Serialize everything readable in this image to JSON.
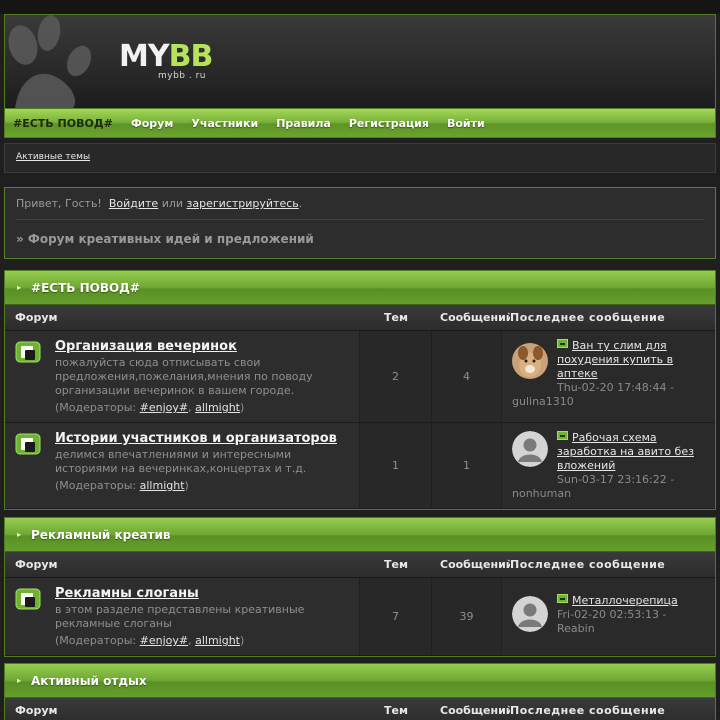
{
  "header": {
    "logo_main": "MY",
    "logo_accent": "BB",
    "logo_sub": "mybb . ru"
  },
  "nav": {
    "items": [
      {
        "label": "#ЕСТЬ ПОВОД#",
        "active": true
      },
      {
        "label": "Форум",
        "active": false
      },
      {
        "label": "Участники",
        "active": false
      },
      {
        "label": "Правила",
        "active": false
      },
      {
        "label": "Регистрация",
        "active": false
      },
      {
        "label": "Войти",
        "active": false
      }
    ]
  },
  "subbar": {
    "active_topics": "Активные темы"
  },
  "greeting": {
    "prefix": "Привет, Гость!",
    "login": "Войдите",
    "or": "или",
    "register": "зарегистрируйтесь",
    "dot": ".",
    "board_title": "» Форум креативных идей и предложений"
  },
  "columns": {
    "forum": "Форум",
    "topics": "Тем",
    "posts": "Сообщений",
    "last": "Последнее сообщение"
  },
  "moderators_label": "(Модераторы:",
  "categories": [
    {
      "title": "#ЕСТЬ ПОВОД#",
      "forums": [
        {
          "name": "Организация вечеринок",
          "desc": "пожалуйста сюда отписывать свои предложения,пожелания,мнения по поводу организации вечеринок в вашем городе.",
          "mods": [
            "#enjoy#",
            "allmight"
          ],
          "topics": "2",
          "posts": "4",
          "last_title": "Ван ту слим для похудения купить в аптеке",
          "last_date": "Thu-02-20 17:48:44 -",
          "last_user": "gulina1310",
          "avatar": "dog"
        },
        {
          "name": "Истории участников и организаторов",
          "desc": "делимся впечатлениями и интересными историями на вечеринках,концертах и т.д.",
          "mods": [
            "allmight"
          ],
          "topics": "1",
          "posts": "1",
          "last_title": "Рабочая схема заработка на авито без вложений",
          "last_date": "Sun-03-17 23:16:22 -",
          "last_user": "nonhuman",
          "avatar": "default"
        }
      ]
    },
    {
      "title": "Рекламный креатив",
      "forums": [
        {
          "name": "Рекламны слоганы",
          "desc": "в этом разделе представлены креативные рекламные слоганы",
          "mods": [
            "#enjoy#",
            "allmight"
          ],
          "topics": "7",
          "posts": "39",
          "last_title": "Металлочерепица",
          "last_date": "Fri-02-20 02:53:13 -",
          "last_user": "Reabin",
          "avatar": "default"
        }
      ]
    },
    {
      "title": "Активный отдых",
      "forums": []
    }
  ],
  "colors": {
    "accent": "#7bb33a",
    "border": "#4f7d1f",
    "bg": "#1f1f1f"
  }
}
